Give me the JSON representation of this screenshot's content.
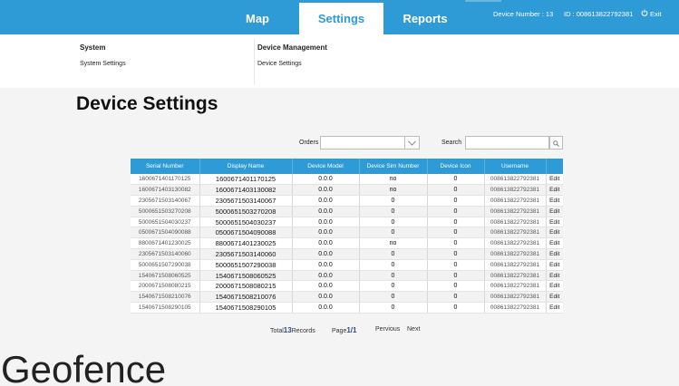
{
  "header": {
    "tabs": [
      {
        "label": "Map"
      },
      {
        "label": "Settings"
      },
      {
        "label": "Reports"
      }
    ],
    "device_number": "Device Number : 13",
    "device_id": "ID : 008613822792381",
    "exit_label": "Exit",
    "accent_color": "#2e9ad6"
  },
  "submenu": {
    "system_heading": "System",
    "system_link": "System Settings",
    "device_heading": "Device Management",
    "device_link": "Device Settings"
  },
  "page": {
    "title": "Device Settings",
    "orders_label": "Orders",
    "orders_value": "",
    "search_label": "Search",
    "search_placeholder": ""
  },
  "table": {
    "columns": [
      "Serial Number",
      "Display Name",
      "Device Model",
      "Device Sim Number",
      "Device Icon",
      "Username",
      ""
    ],
    "rows": [
      [
        "1600671401170125",
        "1600671401170125",
        "0.0.0",
        "no",
        "0",
        "008613822792381",
        "Edit"
      ],
      [
        "1600671403130082",
        "1600671403130082",
        "0.0.0",
        "no",
        "0",
        "008613822792381",
        "Edit"
      ],
      [
        "2305671503140067",
        "2305671503140067",
        "0.0.0",
        "0",
        "0",
        "008613822792381",
        "Edit"
      ],
      [
        "5000651503270208",
        "5000651503270208",
        "0.0.0",
        "0",
        "0",
        "008613822792381",
        "Edit"
      ],
      [
        "5000651504030237",
        "5000651504030237",
        "0.0.0",
        "0",
        "0",
        "008613822792381",
        "Edit"
      ],
      [
        "0500671504090088",
        "0500671504090088",
        "0.0.0",
        "0",
        "0",
        "008613822792381",
        "Edit"
      ],
      [
        "8800671401230025",
        "8800671401230025",
        "0.0.0",
        "no",
        "0",
        "008613822792381",
        "Edit"
      ],
      [
        "2305671503140060",
        "2305671503140060",
        "0.0.0",
        "0",
        "0",
        "008613822792381",
        "Edit"
      ],
      [
        "5000651507290038",
        "5000651507290038",
        "0.0.0",
        "0",
        "0",
        "008613822792381",
        "Edit"
      ],
      [
        "1540671508060525",
        "1540671508060525",
        "0.0.0",
        "0",
        "0",
        "008613822792381",
        "Edit"
      ],
      [
        "2000671508080215",
        "2000671508080215",
        "0.0.0",
        "0",
        "0",
        "008613822792381",
        "Edit"
      ],
      [
        "1540671508210076",
        "1540671508210076",
        "0.0.0",
        "0",
        "0",
        "008613822792381",
        "Edit"
      ],
      [
        "1540671508290105",
        "1540671508290105",
        "0.0.0",
        "0",
        "0",
        "008613822792381",
        "Edit"
      ]
    ]
  },
  "pager": {
    "total_prefix": "Total",
    "total_count": "13",
    "total_suffix": "Records",
    "page_prefix": "Page",
    "page_value": "1/1",
    "prev_label": "Pervious",
    "next_label": "Next"
  },
  "section_title": "Geofence"
}
